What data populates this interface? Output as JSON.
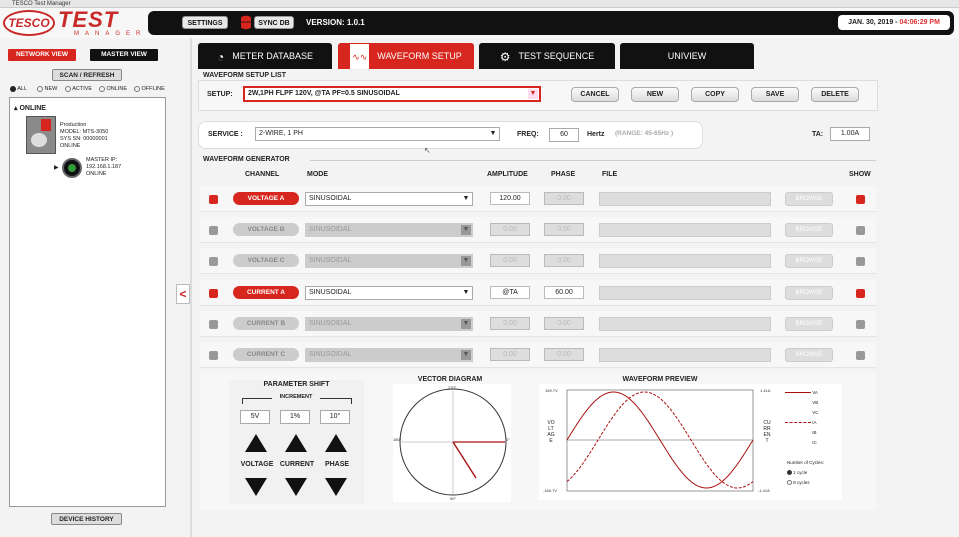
{
  "window": {
    "title": "TESCO Test Manager"
  },
  "header": {
    "logo_left": "TESCO",
    "logo_main": "TEST",
    "logo_sub": "MANAGER",
    "settings": "SETTINGS",
    "sync": "SYNC DB",
    "version": "VERSION: 1.0.1",
    "date": "JAN. 30, 2019 - ",
    "time": "04:06:29 PM"
  },
  "left": {
    "network_view": "NETWORK VIEW",
    "master_view": "MASTER VIEW",
    "scan": "SCAN / REFRESH",
    "filters": [
      "ALL",
      "NEW",
      "ACTIVE",
      "ONLINE",
      "OFFLINE"
    ],
    "online_label": "ONLINE",
    "device": {
      "line1": "Production",
      "line2": "MODEL: MTS-3050",
      "line3": "SYS SN: 00000001",
      "line4": "ONLINE"
    },
    "master": {
      "line1": "MASTER IP:",
      "line2": "192.168.1.187",
      "line3": "ONLINE"
    },
    "device_history": "DEVICE HISTORY"
  },
  "tabs": [
    {
      "label": "METER DATABASE"
    },
    {
      "label": "WAVEFORM SETUP"
    },
    {
      "label": "TEST SEQUENCE"
    },
    {
      "label": "UNIVIEW"
    }
  ],
  "setup": {
    "list_title": "WAVEFORM SETUP LIST",
    "setup_label": "SETUP:",
    "setup_value": "2W,1PH FLPF 120V, @TA PF=0.5 SINUSOIDAL",
    "buttons": [
      "CANCEL",
      "NEW",
      "COPY",
      "SAVE",
      "DELETE"
    ],
    "service_label": "SERVICE :",
    "service_value": "2-WIRE, 1 PH",
    "freq_label": "FREQ:",
    "freq_value": "60",
    "hertz": "Hertz",
    "range": "(RANGE: 45-65Hz )",
    "ta_label": "TA:",
    "ta_value": "1.00A"
  },
  "generator": {
    "title": "WAVEFORM GENERATOR",
    "headers": {
      "channel": "CHANNEL",
      "mode": "MODE",
      "amplitude": "AMPLITUDE",
      "phase": "PHASE",
      "file": "FILE",
      "show": "SHOW"
    },
    "rows": [
      {
        "channel": "VOLTAGE A",
        "mode": "SINUSOIDAL",
        "amplitude": "120.00",
        "phase": "0.00",
        "browse": "BROWSE",
        "active": true
      },
      {
        "channel": "VOLTAGE B",
        "mode": "SINUSOIDAL",
        "amplitude": "0.00",
        "phase": "0.00",
        "browse": "BROWSE",
        "active": false
      },
      {
        "channel": "VOLTAGE C",
        "mode": "SINUSOIDAL",
        "amplitude": "0.00",
        "phase": "0.00",
        "browse": "BROWSE",
        "active": false
      },
      {
        "channel": "CURRENT A",
        "mode": "SINUSOIDAL",
        "amplitude": "@TA",
        "phase": "60.00",
        "browse": "BROWSE",
        "active": true
      },
      {
        "channel": "CURRENT B",
        "mode": "SINUSOIDAL",
        "amplitude": "0.00",
        "phase": "0.00",
        "browse": "BROWSE",
        "active": false
      },
      {
        "channel": "CURRENT C",
        "mode": "SINUSOIDAL",
        "amplitude": "0.00",
        "phase": "0.00",
        "browse": "BROWSE",
        "active": false
      }
    ]
  },
  "param_shift": {
    "title": "PARAMETER SHIFT",
    "increment": "INCREMENT",
    "values": [
      "5V",
      "1%",
      "10°"
    ],
    "labels": [
      "VOLTAGE",
      "CURRENT",
      "PHASE"
    ]
  },
  "vector": {
    "title": "VECTOR DIAGRAM",
    "top": "270°",
    "left": "180°",
    "right": "0°",
    "bottom": "90°"
  },
  "preview": {
    "title": "WAVEFORM PREVIEW",
    "v_max": "169.7V",
    "v_min": "-169.7V",
    "i_max": "1.41A",
    "i_min": "-1.41A",
    "v_axis": "VOLTAGE",
    "i_axis": "CURRENT",
    "legend": [
      "VA",
      "VB",
      "VC",
      "IA",
      "IB",
      "IC"
    ],
    "cycles_label": "Number of Cycles:",
    "cycle_opts": [
      "1 cycle",
      "8 cycles"
    ]
  },
  "colors": {
    "accent": "#d7261e",
    "dark": "#111111"
  }
}
